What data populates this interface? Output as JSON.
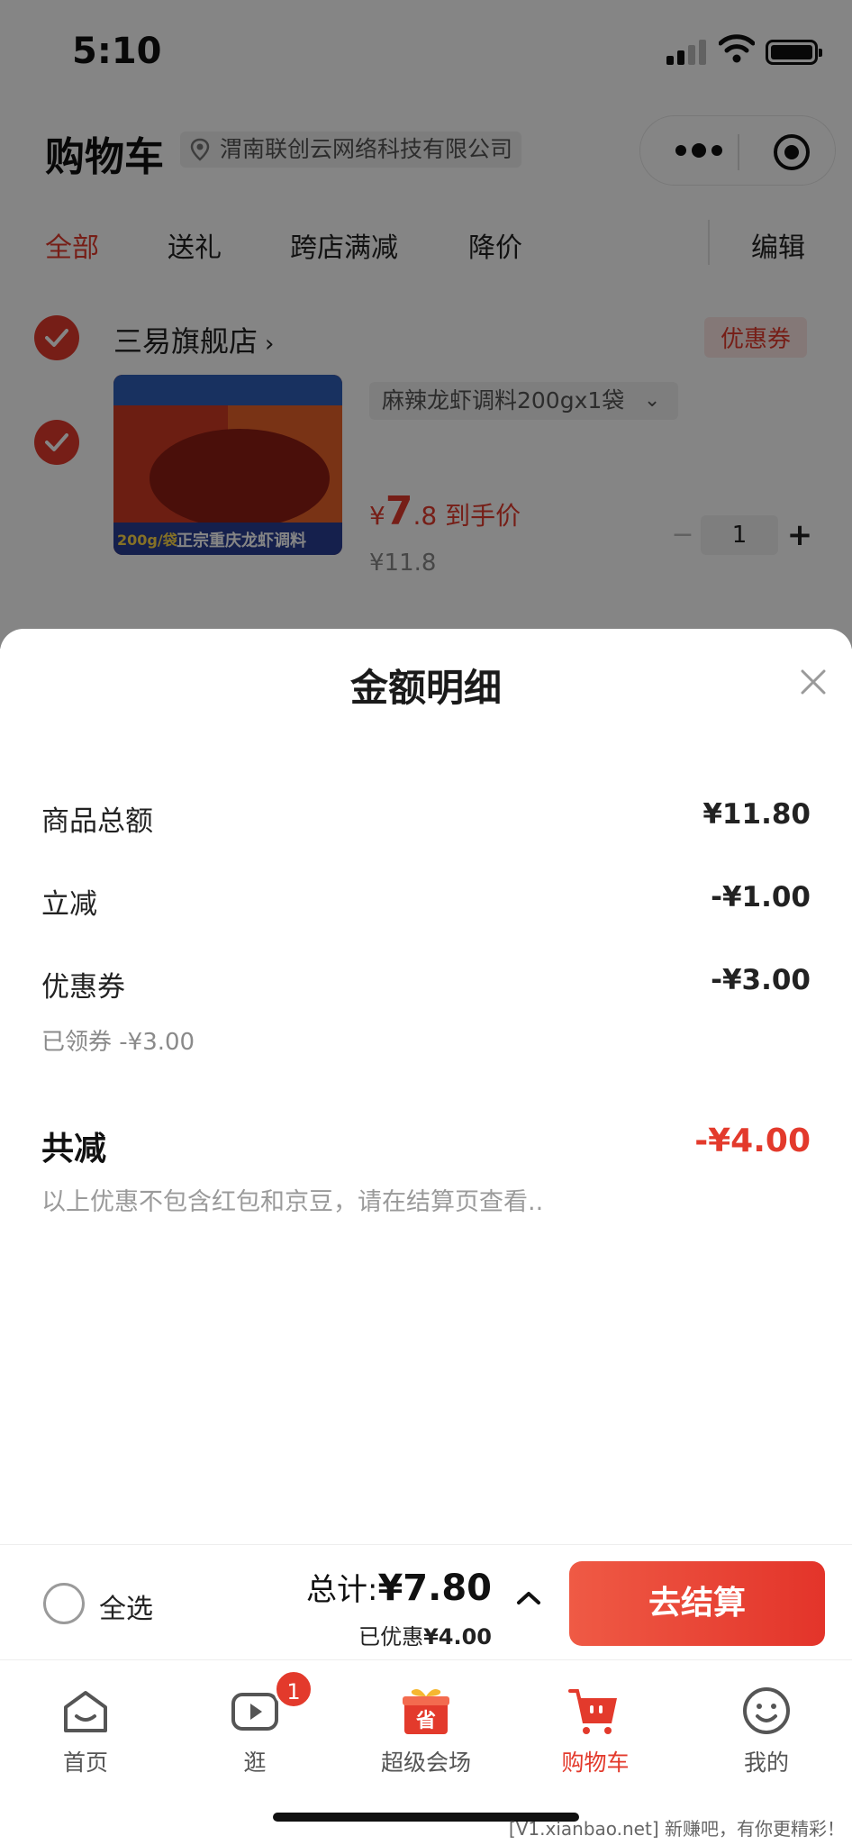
{
  "status": {
    "time": "5:10"
  },
  "header": {
    "title": "购物车",
    "location": "渭南联创云网络科技有限公司"
  },
  "tabs": {
    "items": [
      {
        "label": "全部",
        "active": true
      },
      {
        "label": "送礼",
        "active": false
      },
      {
        "label": "跨店满减",
        "active": false
      },
      {
        "label": "降价",
        "active": false
      }
    ],
    "edit_label": "编辑"
  },
  "store": {
    "name": "三易旗舰店",
    "arrow": "›",
    "coupon_tag": "优惠券",
    "product": {
      "image_text": "正宗重庆龙虾调料",
      "image_weight": "200g/袋",
      "spec": "麻辣龙虾调料200gx1袋",
      "price_symbol": "¥",
      "price_int": "7",
      "price_dec": ".8",
      "price_tag": "到手价",
      "original_price": "¥11.8",
      "quantity": "1"
    }
  },
  "sheet": {
    "title": "金额明细",
    "rows": [
      {
        "label": "商品总额",
        "value": "¥11.80"
      },
      {
        "label": "立减",
        "value": "-¥1.00"
      },
      {
        "label": "优惠券",
        "value": "-¥3.00",
        "sub": "已领券 -¥3.00"
      }
    ],
    "total_label": "共减",
    "total_value": "-¥4.00",
    "note": "以上优惠不包含红包和京豆，请在结算页查看.."
  },
  "checkout": {
    "select_all": "全选",
    "sum_label": "总计:",
    "sum_value": "¥7.80",
    "saved_label": "已优惠",
    "saved_value": "¥4.00",
    "button": "去结算"
  },
  "tabbar": [
    {
      "label": "首页",
      "icon": "home-icon"
    },
    {
      "label": "逛",
      "icon": "video-icon",
      "badge": "1"
    },
    {
      "label": "超级会场",
      "icon": "gift-box-icon",
      "icon_text": "省"
    },
    {
      "label": "购物车",
      "icon": "cart-icon",
      "active": true
    },
    {
      "label": "我的",
      "icon": "smiley-icon"
    }
  ],
  "watermark": "[V1.xianbao.net] 新赚吧，有你更精彩！",
  "colors": {
    "accent": "#e33a2c",
    "button_gradient_start": "#ef5a45",
    "button_gradient_end": "#e3342a"
  }
}
